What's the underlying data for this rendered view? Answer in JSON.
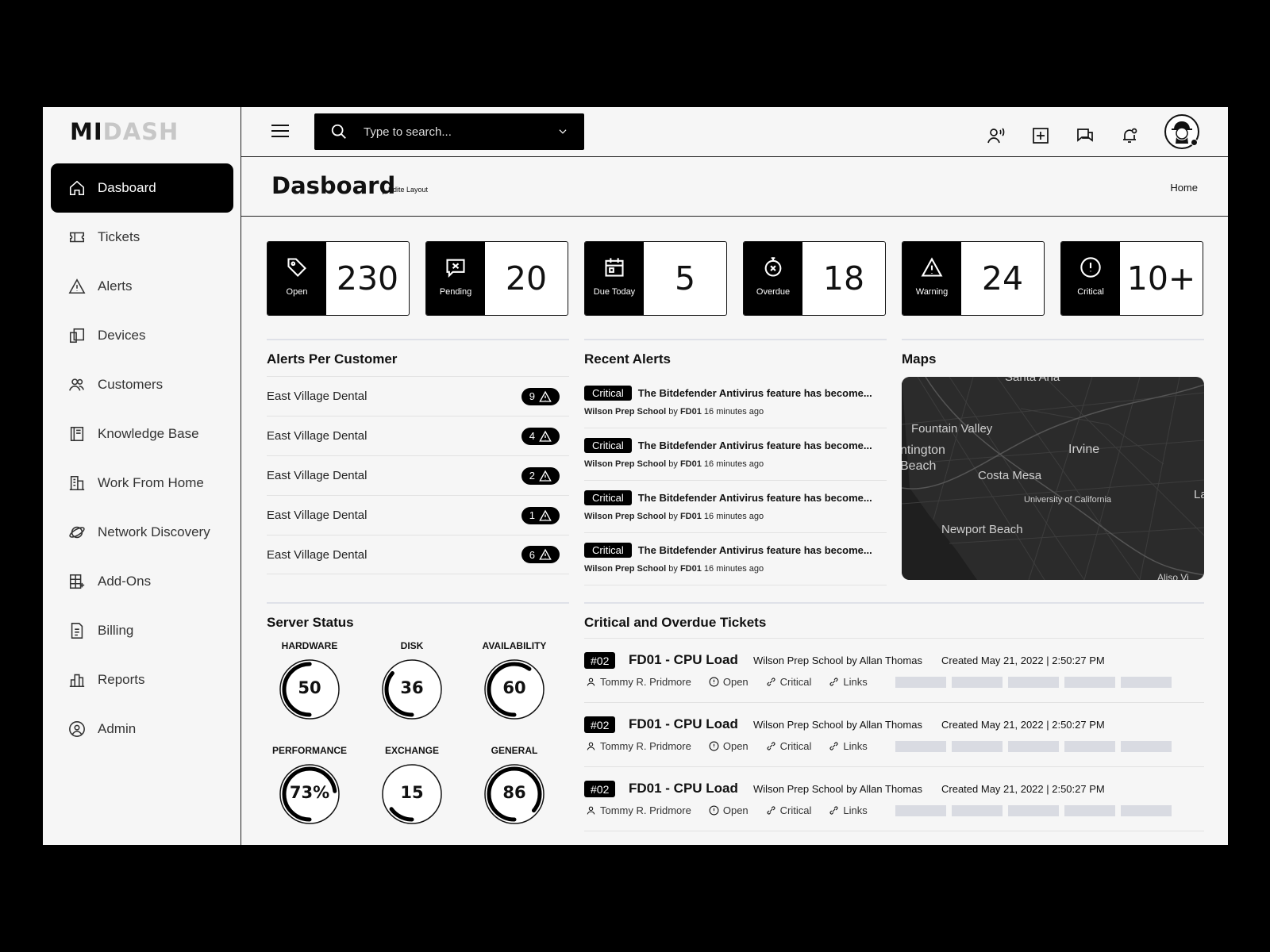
{
  "brand": {
    "part1": "MI",
    "part2": "DASH"
  },
  "sidebar": {
    "items": [
      {
        "label": "Dasboard",
        "icon": "home-icon"
      },
      {
        "label": "Tickets",
        "icon": "ticket-icon"
      },
      {
        "label": "Alerts",
        "icon": "warning-icon"
      },
      {
        "label": "Devices",
        "icon": "devices-icon"
      },
      {
        "label": "Customers",
        "icon": "users-icon"
      },
      {
        "label": "Knowledge Base",
        "icon": "book-icon"
      },
      {
        "label": "Work From Home",
        "icon": "building-icon"
      },
      {
        "label": "Network Discovery",
        "icon": "planet-icon"
      },
      {
        "label": "Add-Ons",
        "icon": "grid-plus-icon"
      },
      {
        "label": "Billing",
        "icon": "document-icon"
      },
      {
        "label": "Reports",
        "icon": "bar-chart-icon"
      },
      {
        "label": "Admin",
        "icon": "user-circle-icon"
      }
    ]
  },
  "search": {
    "placeholder": "Type to search..."
  },
  "header": {
    "title": "Dasboard",
    "edit_layout": "Edite Layout",
    "breadcrumb": "Home"
  },
  "stats": [
    {
      "label": "Open",
      "value": "230",
      "icon": "tag-icon"
    },
    {
      "label": "Pending",
      "value": "20",
      "icon": "message-x-icon"
    },
    {
      "label": "Due Today",
      "value": "5",
      "icon": "calendar-icon"
    },
    {
      "label": "Overdue",
      "value": "18",
      "icon": "stopwatch-x-icon"
    },
    {
      "label": "Warning",
      "value": "24",
      "icon": "warning-icon"
    },
    {
      "label": "Critical",
      "value": "10+",
      "icon": "alert-circle-icon"
    }
  ],
  "alerts_per_customer": {
    "title": "Alerts Per Customer",
    "rows": [
      {
        "name": "East Village Dental",
        "count": "9"
      },
      {
        "name": "East Village Dental",
        "count": "4"
      },
      {
        "name": "East Village Dental",
        "count": "2"
      },
      {
        "name": "East Village Dental",
        "count": "1"
      },
      {
        "name": "East Village Dental",
        "count": "6"
      }
    ]
  },
  "recent_alerts": {
    "title": "Recent Alerts",
    "items": [
      {
        "level": "Critical",
        "text": "The Bitdefender Antivirus feature has become...",
        "school": "Wilson Prep School",
        "by": "by",
        "device": "FD01",
        "time": "16 minutes ago"
      },
      {
        "level": "Critical",
        "text": "The Bitdefender Antivirus feature has become...",
        "school": "Wilson Prep School",
        "by": "by",
        "device": "FD01",
        "time": "16 minutes ago"
      },
      {
        "level": "Critical",
        "text": "The Bitdefender Antivirus feature has become...",
        "school": "Wilson Prep School",
        "by": "by",
        "device": "FD01",
        "time": "16 minutes ago"
      },
      {
        "level": "Critical",
        "text": "The Bitdefender Antivirus feature has become...",
        "school": "Wilson Prep School",
        "by": "by",
        "device": "FD01",
        "time": "16 minutes ago"
      }
    ]
  },
  "maps": {
    "title": "Maps",
    "labels": [
      "Santa Ana",
      "Fountain Valley",
      "ntington",
      "Beach",
      "Irvine",
      "Costa Mesa",
      "University of California",
      "Newport Beach",
      "La",
      "Aliso Vi"
    ]
  },
  "server_status": {
    "title": "Server Status",
    "gauges": [
      {
        "label": "HARDWARE",
        "value": "50",
        "level": 0.5
      },
      {
        "label": "DISK",
        "value": "36",
        "level": 0.36
      },
      {
        "label": "AVAILABILITY",
        "value": "60",
        "level": 0.6
      },
      {
        "label": "PERFORMANCE",
        "value": "73%",
        "level": 0.73
      },
      {
        "label": "EXCHANGE",
        "value": "15",
        "level": 0.15
      },
      {
        "label": "GENERAL",
        "value": "86",
        "level": 0.86
      }
    ]
  },
  "tickets": {
    "title": "Critical and Overdue Tickets",
    "items": [
      {
        "id": "#02",
        "title": "FD01 - CPU Load",
        "school": "Wilson Prep School",
        "by": "by",
        "person": "Allan Thomas",
        "created": "Created May 21, 2022 | 2:50:27 PM",
        "assignee": "Tommy R. Pridmore",
        "status": "Open",
        "priority": "Critical",
        "links": "Links"
      },
      {
        "id": "#02",
        "title": "FD01 - CPU Load",
        "school": "Wilson Prep School",
        "by": "by",
        "person": "Allan Thomas",
        "created": "Created May 21, 2022 | 2:50:27 PM",
        "assignee": "Tommy R. Pridmore",
        "status": "Open",
        "priority": "Critical",
        "links": "Links"
      },
      {
        "id": "#02",
        "title": "FD01 - CPU Load",
        "school": "Wilson Prep School",
        "by": "by",
        "person": "Allan Thomas",
        "created": "Created May 21, 2022 | 2:50:27 PM",
        "assignee": "Tommy R. Pridmore",
        "status": "Open",
        "priority": "Critical",
        "links": "Links"
      }
    ]
  },
  "colors": {
    "accent": "#000000",
    "background": "#f6f6f6",
    "placeholder_bar": "#d9dbe2",
    "map_bg": "#2b2b2b"
  }
}
